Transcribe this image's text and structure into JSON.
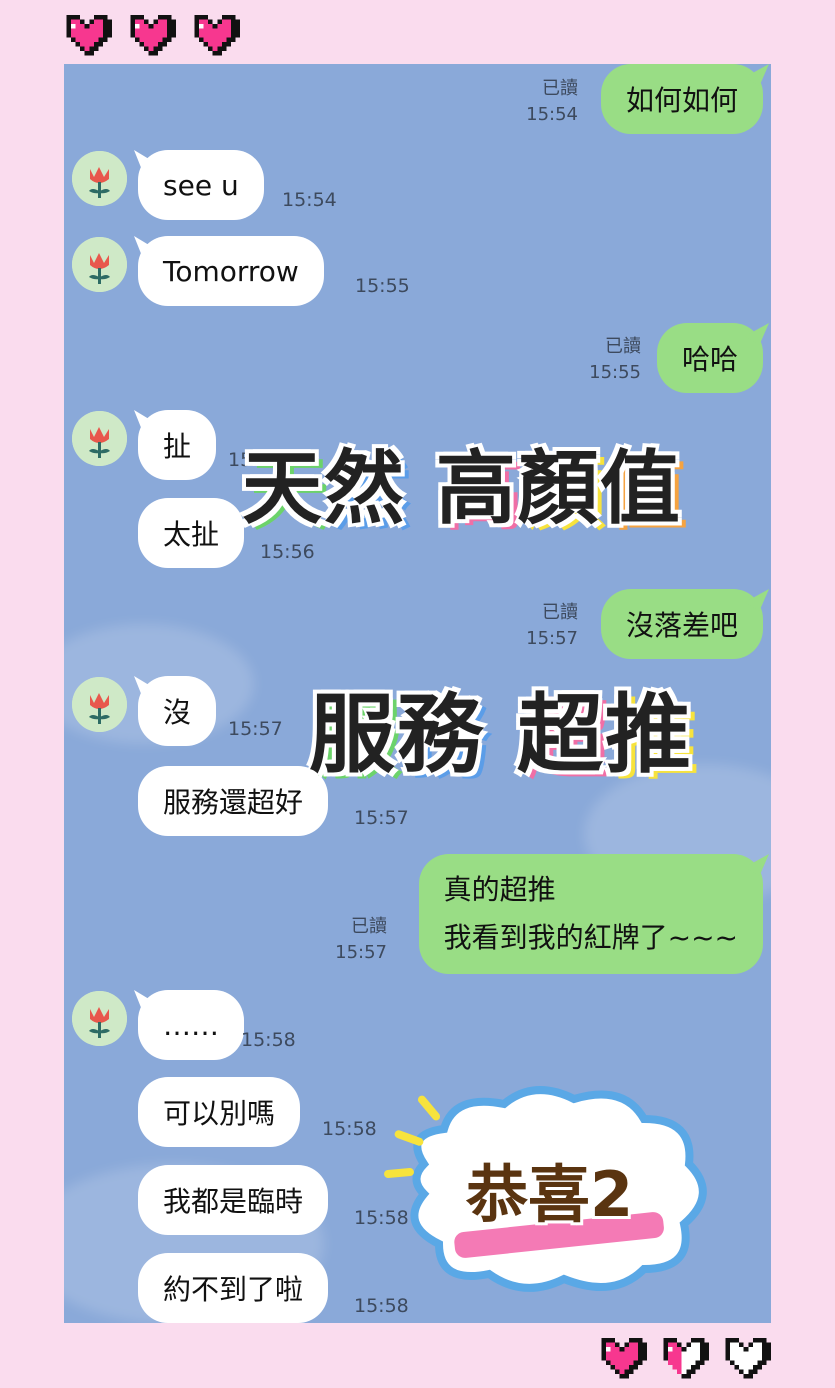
{
  "messages": [
    {
      "side": "out",
      "text": "如何如何",
      "read": "已讀",
      "time": "15:54"
    },
    {
      "side": "in",
      "text": "see u",
      "time": "15:54"
    },
    {
      "side": "in",
      "text": "Tomorrow",
      "time": "15:55"
    },
    {
      "side": "out",
      "text": "哈哈",
      "read": "已讀",
      "time": "15:55"
    },
    {
      "side": "in",
      "text": "扯",
      "time": "15:5"
    },
    {
      "side": "in",
      "text": "太扯",
      "time": "15:56"
    },
    {
      "side": "out",
      "text": "沒落差吧",
      "read": "已讀",
      "time": "15:57"
    },
    {
      "side": "in",
      "text": "沒",
      "time": "15:57"
    },
    {
      "side": "in",
      "text": "服務還超好",
      "time": "15:57"
    },
    {
      "side": "out",
      "text": "真的超推\n我看到我的紅牌了~~~",
      "read": "已讀",
      "time": "15:57"
    },
    {
      "side": "in",
      "text": "……",
      "time": "15:58"
    },
    {
      "side": "in",
      "text": "可以別嗎",
      "time": "15:58"
    },
    {
      "side": "in",
      "text": "我都是臨時",
      "time": "15:58"
    },
    {
      "side": "in",
      "text": "約不到了啦",
      "time": "15:58"
    }
  ],
  "stickers": {
    "line1": [
      "天",
      "然",
      "高",
      "顏",
      "值"
    ],
    "line2": [
      "服",
      "務",
      "超",
      "推"
    ],
    "congrats": "恭喜2"
  },
  "colors": {
    "page_bg": "#fadcee",
    "chat_bg": "#8aa9d9",
    "bubble_in": "#ffffff",
    "bubble_out": "#99dd85",
    "heart": "#f7378f"
  },
  "icons": {
    "avatar": "tulip-icon",
    "top_hearts": [
      "pixel-heart-full",
      "pixel-heart-full",
      "pixel-heart-full"
    ],
    "bottom_hearts": [
      "pixel-heart-full",
      "pixel-heart-half",
      "pixel-heart-empty"
    ]
  }
}
